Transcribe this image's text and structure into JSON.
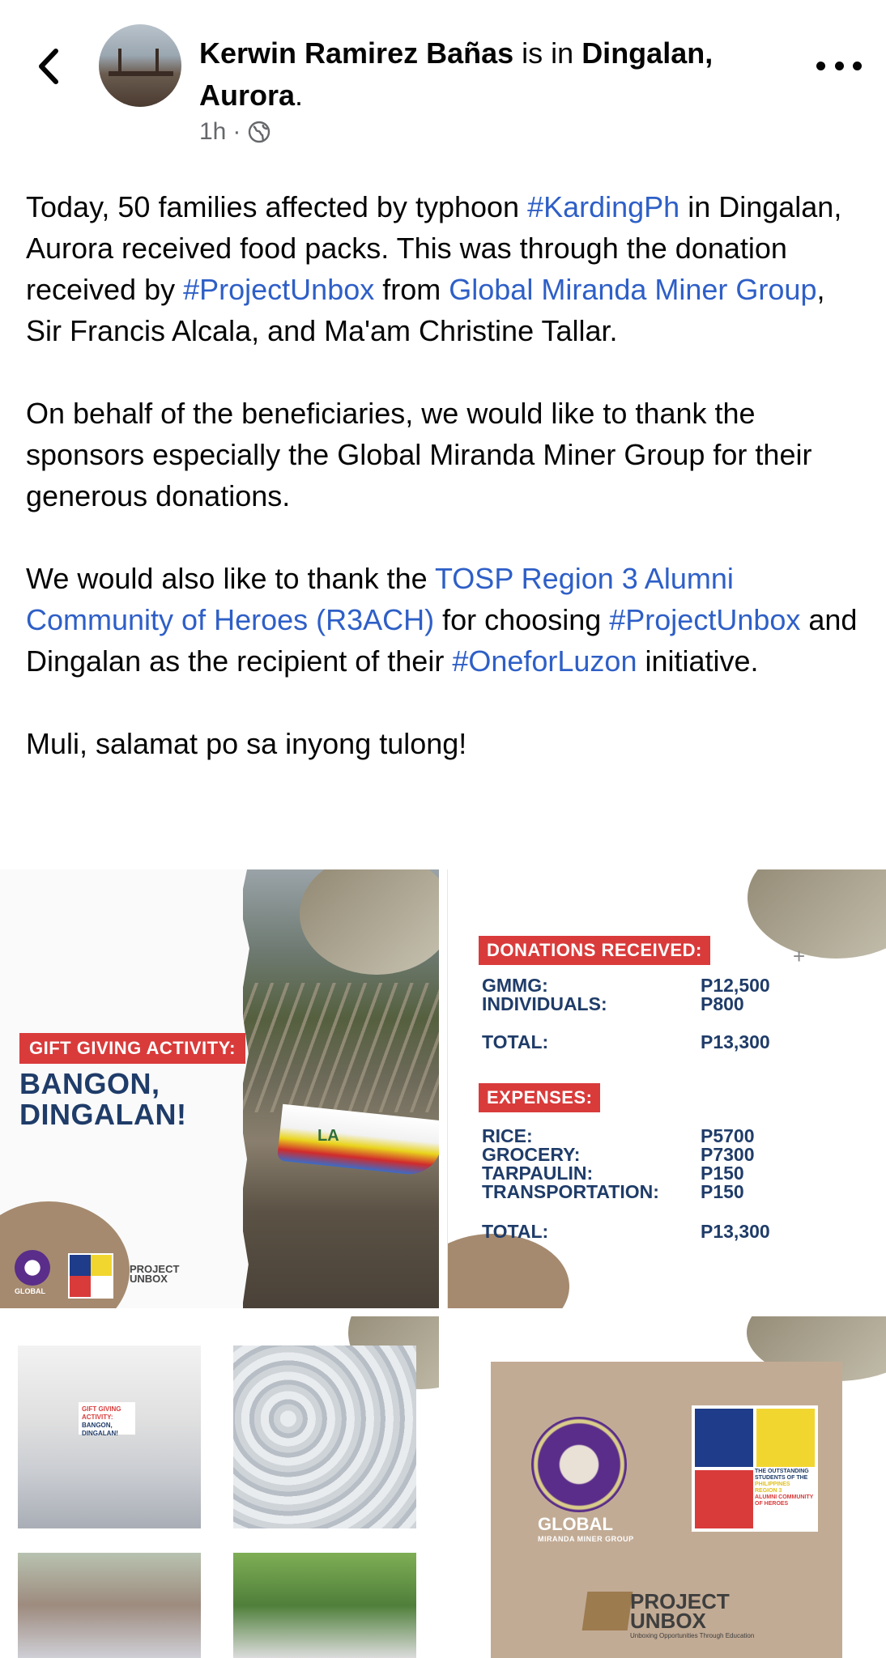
{
  "header": {
    "author": "Kerwin Ramirez Bañas",
    "is_in": " is in ",
    "location": "Dingalan, Aurora",
    "period": ".",
    "time": "1h",
    "separator": "·",
    "audience_icon": "globe-icon",
    "back_icon": "chevron-left-icon",
    "more_icon": "more-horizontal-icon"
  },
  "post": {
    "p1": {
      "a": "Today, 50 families affected by typhoon ",
      "tag1": "#KardingPh",
      "b": " in Dingalan, Aurora received food packs. This was through the donation received by ",
      "tag2": "#ProjectUnbox",
      "c": " from ",
      "link1": "Global Miranda Miner Group",
      "d": ", Sir Francis Alcala, and Ma'am Christine Tallar."
    },
    "p2": "On behalf of the beneficiaries, we would like to thank the sponsors especially the Global Miranda Miner Group for their generous donations.",
    "p3": {
      "a": "We would also like to thank the ",
      "link1": "TOSP Region 3 Alumni Community of Heroes (R3ACH)",
      "b": " for choosing ",
      "tag1": "#ProjectUnbox",
      "c": " and Dingalan as the recipient of their ",
      "tag2": "#OneforLuzon",
      "d": " initiative."
    },
    "p4": "Muli, salamat po sa inyong tulong!"
  },
  "colors": {
    "link": "#2e5fc7",
    "muted": "#65676b",
    "badge_red": "#d93b3b",
    "navy": "#1f3c69",
    "tan": "#c2ab95",
    "purple": "#5a2d8a"
  },
  "tile1": {
    "badge": "GIFT GIVING ACTIVITY:",
    "headline1": "BANGON,",
    "headline2": "DINGALAN!",
    "boat_text": "LA",
    "global_logo_text": "GLOBAL",
    "unbox_logo_1": "PROJECT",
    "unbox_logo_2": "UNBOX"
  },
  "tile2": {
    "donations_header": "DONATIONS RECEIVED:",
    "donations": [
      {
        "label": "GMMG:",
        "amount": "P12,500"
      },
      {
        "label": "INDIVIDUALS:",
        "amount": "P800"
      }
    ],
    "donations_total": {
      "label": "TOTAL:",
      "amount": "P13,300"
    },
    "expenses_header": "EXPENSES:",
    "expenses": [
      {
        "label": "RICE:",
        "amount": "P5700"
      },
      {
        "label": "GROCERY:",
        "amount": "P7300"
      },
      {
        "label": "TARPAULIN:",
        "amount": "P150"
      },
      {
        "label": "TRANSPORTATION:",
        "amount": "P150"
      }
    ],
    "expenses_total": {
      "label": "TOTAL:",
      "amount": "P13,300"
    },
    "plus": "+"
  },
  "tile3": {
    "sign_line1": "GIFT GIVING ACTIVITY:",
    "sign_line2": "BANGON,",
    "sign_line3": "DINGALAN!"
  },
  "tile4": {
    "global_text": "GLOBAL",
    "global_sub": "MIRANDA MINER GROUP",
    "tosp_lines": [
      "THE OUTSTANDING",
      "STUDENTS OF THE",
      "PHILIPPINES",
      "REGION 3",
      "ALUMNI COMMUNITY",
      "OF HEROES"
    ],
    "unbox_1": "PROJECT",
    "unbox_2": "UNBOX",
    "unbox_sub": "Unboxing Opportunities Through Education"
  }
}
